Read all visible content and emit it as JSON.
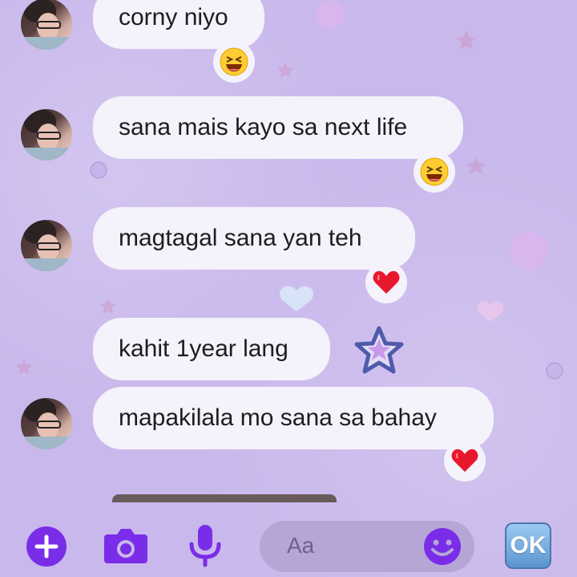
{
  "messages": [
    {
      "text": "corny niyo",
      "reaction": "laughing-emoji"
    },
    {
      "text": "sana mais kayo sa next life",
      "reaction": "laughing-emoji"
    },
    {
      "text": "magtagal sana yan teh",
      "reaction": "red-heart-emoji"
    },
    {
      "text": "kahit 1year lang"
    },
    {
      "text": "mapakilala mo sana sa bahay",
      "reaction": "red-heart-emoji"
    }
  ],
  "composer": {
    "placeholder": "Aa",
    "ok_label": "OK",
    "icons": [
      "plus-icon",
      "camera-icon",
      "microphone-icon",
      "smiley-icon"
    ]
  },
  "colors": {
    "background": "#c9b8ec",
    "bubble": "#f4f2fa",
    "accent": "#7a2de8"
  }
}
